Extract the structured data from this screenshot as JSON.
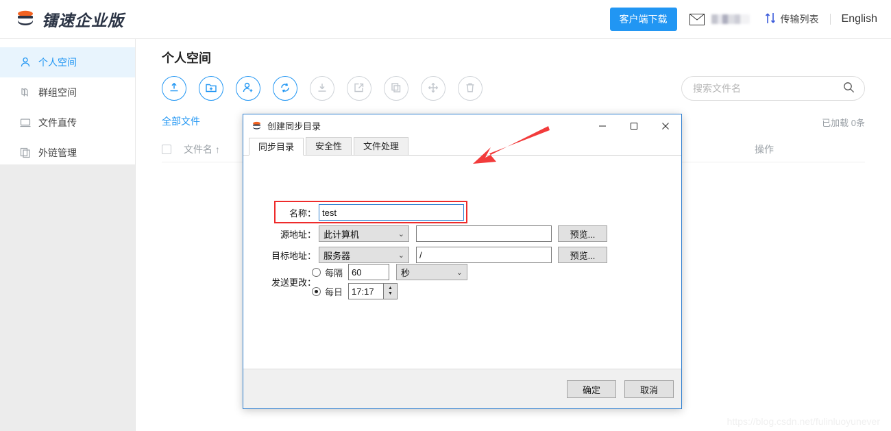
{
  "header": {
    "brand_title": "镭速企业版",
    "brand_logo_icon": "raysync-logo-icon",
    "client_download_label": "客户端下载",
    "mail_icon": "mail-icon",
    "username_masked": "",
    "transfer_icon": "transfer-arrows-icon",
    "transfer_label": "传输列表",
    "language_label": "English"
  },
  "sidebar": {
    "items": [
      {
        "label": "个人空间",
        "icon": "user-icon",
        "active": true
      },
      {
        "label": "群组空间",
        "icon": "group-icon",
        "active": false
      },
      {
        "label": "文件直传",
        "icon": "monitor-icon",
        "active": false
      },
      {
        "label": "外链管理",
        "icon": "link-copy-icon",
        "active": false
      }
    ]
  },
  "main": {
    "page_title": "个人空间",
    "toolbar": [
      {
        "name": "upload-button",
        "icon": "upload-icon",
        "enabled": true
      },
      {
        "name": "new-folder-button",
        "icon": "folder-plus-icon",
        "enabled": true
      },
      {
        "name": "share-user-button",
        "icon": "user-plus-icon",
        "enabled": true
      },
      {
        "name": "sync-button",
        "icon": "sync-icon",
        "enabled": true
      },
      {
        "name": "download-button",
        "icon": "download-icon",
        "enabled": false
      },
      {
        "name": "external-link-button",
        "icon": "external-link-icon",
        "enabled": false
      },
      {
        "name": "copy-button",
        "icon": "copy-icon",
        "enabled": false
      },
      {
        "name": "move-button",
        "icon": "move-icon",
        "enabled": false
      },
      {
        "name": "delete-button",
        "icon": "trash-icon",
        "enabled": false
      }
    ],
    "search": {
      "placeholder": "搜索文件名",
      "value": "",
      "icon": "search-icon"
    },
    "breadcrumb": "全部文件",
    "loaded_count": "已加载 0条",
    "columns": {
      "filename": "文件名 ↑",
      "operation": "操作"
    },
    "rows": []
  },
  "dialog": {
    "title": "创建同步目录",
    "icon": "raysync-logo-icon",
    "window_buttons": {
      "minimize": "—",
      "maximize": "□",
      "close": "✕"
    },
    "tabs": [
      {
        "label": "同步目录",
        "active": true
      },
      {
        "label": "安全性",
        "active": false
      },
      {
        "label": "文件处理",
        "active": false
      }
    ],
    "form": {
      "name_label": "名称：",
      "name_value": "test",
      "source_label": "源地址：",
      "source_select": "此计算机",
      "source_path": "",
      "source_browse": "预览...",
      "target_label": "目标地址：",
      "target_select": "服务器",
      "target_path": "/",
      "target_browse": "预览...",
      "send_changes_label": "发送更改：",
      "interval_radio_label": "每隔",
      "interval_value": "60",
      "interval_unit": "秒",
      "interval_selected": false,
      "daily_radio_label": "每日",
      "daily_value": "17:17",
      "daily_selected": true
    },
    "footer": {
      "ok_label": "确定",
      "cancel_label": "取消"
    }
  },
  "annotations": {
    "highlight_color": "#ee2b2b",
    "arrow_name": "red-arrow-annotation"
  },
  "watermark": "https://blog.csdn.net/fulinluoyunever"
}
